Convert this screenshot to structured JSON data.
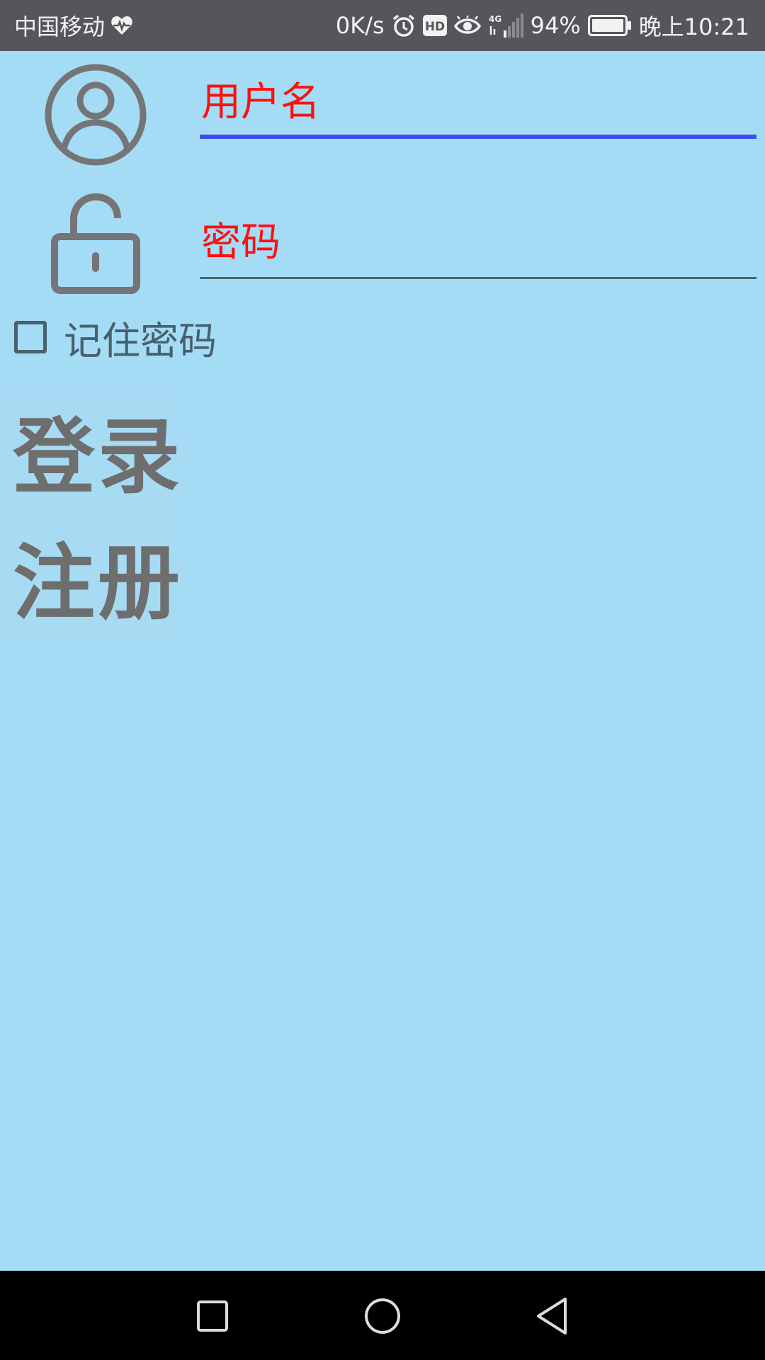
{
  "status_bar": {
    "carrier": "中国移动",
    "net_speed": "0K/s",
    "hd_badge": "HD",
    "network_type": "4G",
    "battery": "94%",
    "time": "晚上10:21",
    "icons": [
      "heartbeat-icon",
      "alarm-icon",
      "hd-icon",
      "eye-icon",
      "signal-icon",
      "battery-icon"
    ]
  },
  "form": {
    "username": {
      "value": "用户名",
      "icon": "user-icon"
    },
    "password": {
      "value": "密码",
      "icon": "lock-icon"
    },
    "remember_label": "记住密码",
    "remember_checked": false
  },
  "buttons": {
    "login": "登录",
    "register": "注册"
  },
  "colors": {
    "background": "#a4dcf6",
    "field_text": "#ff1010",
    "active_underline": "#3d4de8",
    "status_bar": "#56555c"
  },
  "nav": {
    "icons": [
      "recent-apps-icon",
      "home-icon",
      "back-icon"
    ]
  }
}
